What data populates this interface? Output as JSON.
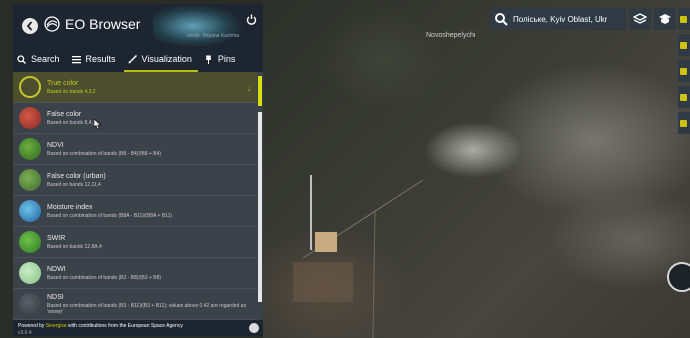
{
  "header": {
    "app_name": "EO Browser",
    "credit": "credit: Tetyana Kuchma"
  },
  "tabs": [
    {
      "label": "Search",
      "icon": "search-icon"
    },
    {
      "label": "Results",
      "icon": "list-icon"
    },
    {
      "label": "Visualization",
      "icon": "brush-icon",
      "active": true
    },
    {
      "label": "Pins",
      "icon": "pin-icon"
    }
  ],
  "visualizations": [
    {
      "name": "True color",
      "desc": "Based on bands 4,3,2",
      "color": "#3b4249",
      "selected": true
    },
    {
      "name": "False color",
      "desc": "Based on bands 8,4,3",
      "color": "#a0342b"
    },
    {
      "name": "NDVI",
      "desc": "Based on combination of bands (B8 - B4)/(B8 + B4)",
      "color": "#3d7a2a"
    },
    {
      "name": "False color (urban)",
      "desc": "Based on bands 12,11,4",
      "color": "#4f7a36"
    },
    {
      "name": "Moisture index",
      "desc": "Based on combination of bands (B8A - B11)/(B8A + B11)",
      "color": "#2a78b4"
    },
    {
      "name": "SWIR",
      "desc": "Based on bands 12,8A,4",
      "color": "#3c8a2c"
    },
    {
      "name": "NDWI",
      "desc": "Based on combination of bands (B3 - B8)/(B3 + B8)",
      "color": "#9ad19a"
    },
    {
      "name": "NDSI",
      "desc": "Based on combination of bands (B3 - B11)/(B3 + B11); values above 0.42 are regarded as 'snowy'",
      "color": "#4a5057"
    }
  ],
  "footer": {
    "powered_prefix": "Powered by",
    "powered_brand": "Sinergise",
    "powered_suffix": "with contributions from the European Space Agency",
    "version": "v3.0.4"
  },
  "map": {
    "place_label": "Novoshepelychi",
    "search_value": "Поліське, Kyiv Oblast, Ukr"
  },
  "colors": {
    "accent": "#b6bf00",
    "panel": "#3a4148",
    "header": "#1d2630"
  }
}
